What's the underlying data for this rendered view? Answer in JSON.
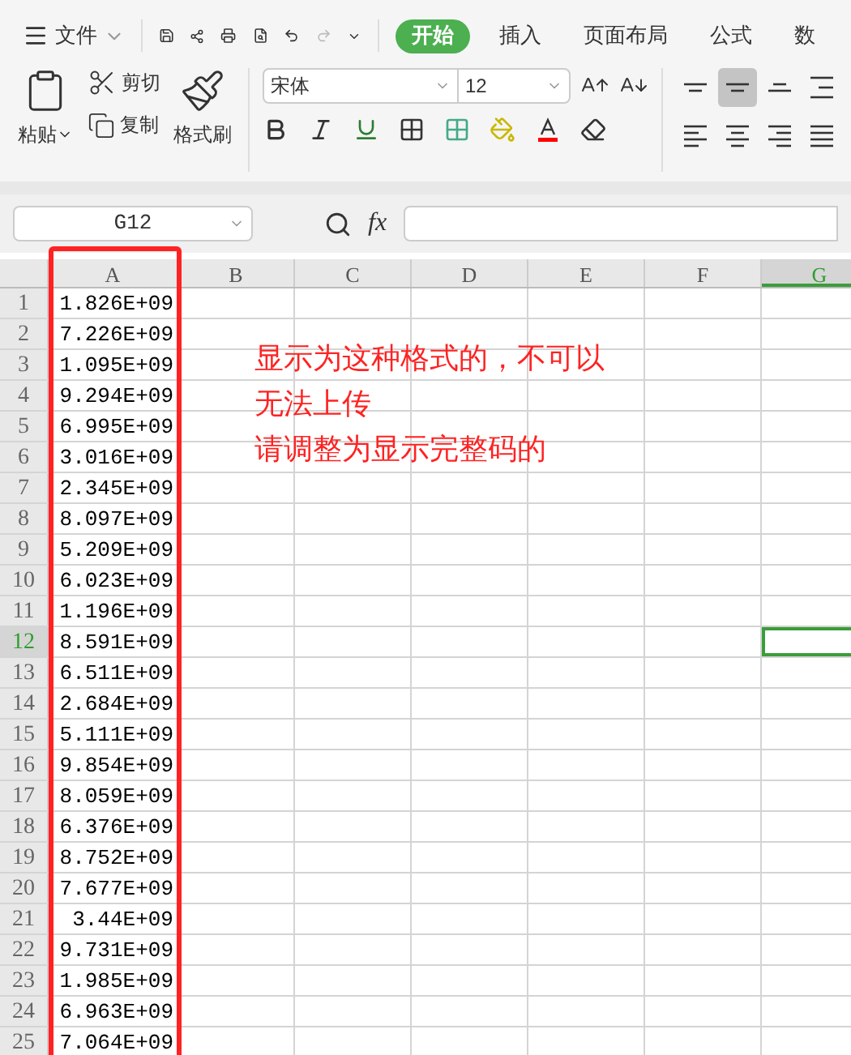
{
  "menu": {
    "label": "文件"
  },
  "tabs": [
    {
      "label": "开始",
      "selected": true
    },
    {
      "label": "插入",
      "selected": false
    },
    {
      "label": "页面布局",
      "selected": false
    },
    {
      "label": "公式",
      "selected": false
    },
    {
      "label": "数",
      "selected": false
    }
  ],
  "clipboard": {
    "paste": "粘贴",
    "cut": "剪切",
    "copy": "复制",
    "format_painter": "格式刷"
  },
  "font": {
    "name": "宋体",
    "size": "12"
  },
  "align_buttons": [
    {
      "kind": "top",
      "selected": false
    },
    {
      "kind": "middle",
      "selected": true
    },
    {
      "kind": "bottom",
      "selected": false
    },
    {
      "kind": "indent",
      "selected": false
    },
    {
      "kind": "left",
      "selected": false
    },
    {
      "kind": "center",
      "selected": false
    },
    {
      "kind": "right",
      "selected": false
    },
    {
      "kind": "justify",
      "selected": false
    }
  ],
  "name_box": "G12",
  "formula_label": "fx",
  "columns": [
    {
      "label": "A",
      "selected": false
    },
    {
      "label": "B",
      "selected": false
    },
    {
      "label": "C",
      "selected": false
    },
    {
      "label": "D",
      "selected": false
    },
    {
      "label": "E",
      "selected": false
    },
    {
      "label": "F",
      "selected": false
    },
    {
      "label": "G",
      "selected": true
    }
  ],
  "rows": [
    {
      "number": "1",
      "value": "1.826E+09",
      "selected": false
    },
    {
      "number": "2",
      "value": "7.226E+09",
      "selected": false
    },
    {
      "number": "3",
      "value": "1.095E+09",
      "selected": false
    },
    {
      "number": "4",
      "value": "9.294E+09",
      "selected": false
    },
    {
      "number": "5",
      "value": "6.995E+09",
      "selected": false
    },
    {
      "number": "6",
      "value": "3.016E+09",
      "selected": false
    },
    {
      "number": "7",
      "value": "2.345E+09",
      "selected": false
    },
    {
      "number": "8",
      "value": "8.097E+09",
      "selected": false
    },
    {
      "number": "9",
      "value": "5.209E+09",
      "selected": false
    },
    {
      "number": "10",
      "value": "6.023E+09",
      "selected": false
    },
    {
      "number": "11",
      "value": "1.196E+09",
      "selected": false
    },
    {
      "number": "12",
      "value": "8.591E+09",
      "selected": true
    },
    {
      "number": "13",
      "value": "6.511E+09",
      "selected": false
    },
    {
      "number": "14",
      "value": "2.684E+09",
      "selected": false
    },
    {
      "number": "15",
      "value": "5.111E+09",
      "selected": false
    },
    {
      "number": "16",
      "value": "9.854E+09",
      "selected": false
    },
    {
      "number": "17",
      "value": "8.059E+09",
      "selected": false
    },
    {
      "number": "18",
      "value": "6.376E+09",
      "selected": false
    },
    {
      "number": "19",
      "value": "8.752E+09",
      "selected": false
    },
    {
      "number": "20",
      "value": "7.677E+09",
      "selected": false
    },
    {
      "number": "21",
      "value": "3.44E+09",
      "selected": false
    },
    {
      "number": "22",
      "value": "9.731E+09",
      "selected": false
    },
    {
      "number": "23",
      "value": "1.985E+09",
      "selected": false
    },
    {
      "number": "24",
      "value": "6.963E+09",
      "selected": false
    },
    {
      "number": "25",
      "value": "7.064E+09",
      "selected": false
    }
  ],
  "annotation": {
    "lines": [
      "显示为这种格式的，不可以",
      "无法上传",
      "请调整为显示完整码的"
    ]
  }
}
